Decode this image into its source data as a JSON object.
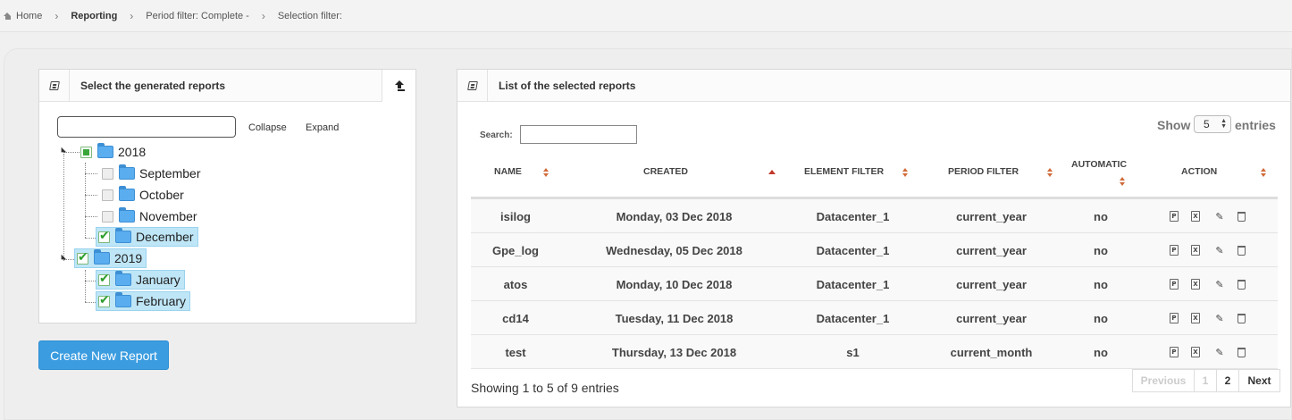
{
  "breadcrumb": {
    "home": "Home",
    "items": [
      "Reporting",
      "Period filter: Complete -",
      "Selection filter:"
    ]
  },
  "left_panel": {
    "title": "Select the generated reports",
    "search_value": "",
    "collapse_label": "Collapse",
    "expand_label": "Expand",
    "tree": [
      {
        "label": "2018",
        "state": "partial",
        "children": [
          {
            "label": "September",
            "state": "off"
          },
          {
            "label": "October",
            "state": "off"
          },
          {
            "label": "November",
            "state": "off"
          },
          {
            "label": "December",
            "state": "on"
          }
        ]
      },
      {
        "label": "2019",
        "state": "on",
        "children": [
          {
            "label": "January",
            "state": "on"
          },
          {
            "label": "February",
            "state": "on"
          }
        ]
      }
    ],
    "create_button": "Create New Report"
  },
  "right_panel": {
    "title": "List of the selected reports",
    "search_label": "Search:",
    "search_value": "",
    "show_label": "Show",
    "show_value": "5",
    "entries_label": "entries",
    "columns": [
      "NAME",
      "CREATED",
      "ELEMENT FILTER",
      "PERIOD FILTER",
      "AUTOMATIC",
      "ACTION"
    ],
    "rows": [
      {
        "name": "isilog",
        "created": "Monday, 03 Dec 2018",
        "element_filter": "Datacenter_1",
        "period_filter": "current_year",
        "automatic": "no"
      },
      {
        "name": "Gpe_log",
        "created": "Wednesday, 05 Dec 2018",
        "element_filter": "Datacenter_1",
        "period_filter": "current_year",
        "automatic": "no"
      },
      {
        "name": "atos",
        "created": "Monday, 10 Dec 2018",
        "element_filter": "Datacenter_1",
        "period_filter": "current_year",
        "automatic": "no"
      },
      {
        "name": "cd14",
        "created": "Tuesday, 11 Dec 2018",
        "element_filter": "Datacenter_1",
        "period_filter": "current_year",
        "automatic": "no"
      },
      {
        "name": "test",
        "created": "Thursday, 13 Dec 2018",
        "element_filter": "s1",
        "period_filter": "current_month",
        "automatic": "no"
      }
    ],
    "info": "Showing 1 to 5 of 9 entries",
    "pagination": {
      "previous": "Previous",
      "pages": [
        "1",
        "2"
      ],
      "next": "Next"
    }
  },
  "colors": {
    "accent": "#3b9ce0",
    "selected_bg": "#bfe6f7",
    "sort": "#d06b3a"
  }
}
